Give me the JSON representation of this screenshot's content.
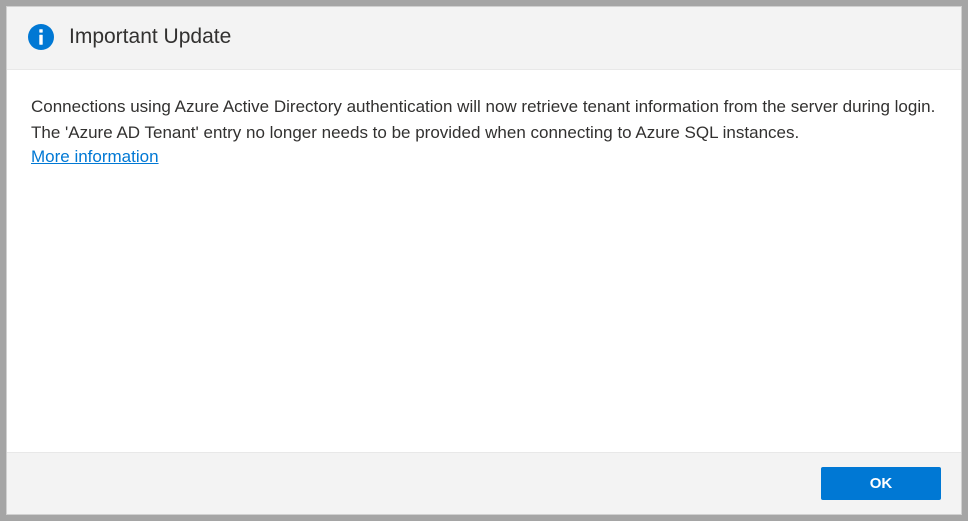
{
  "dialog": {
    "title": "Important Update",
    "body_text": "Connections using Azure Active Directory authentication will now retrieve tenant information from the server during login. The 'Azure AD Tenant' entry no longer needs to be provided when connecting to Azure SQL instances.",
    "link_text": "More information",
    "ok_label": "OK"
  },
  "colors": {
    "accent": "#0078d4",
    "header_bg": "#f3f3f3",
    "footer_bg": "#f3f3f3",
    "text": "#323130"
  }
}
